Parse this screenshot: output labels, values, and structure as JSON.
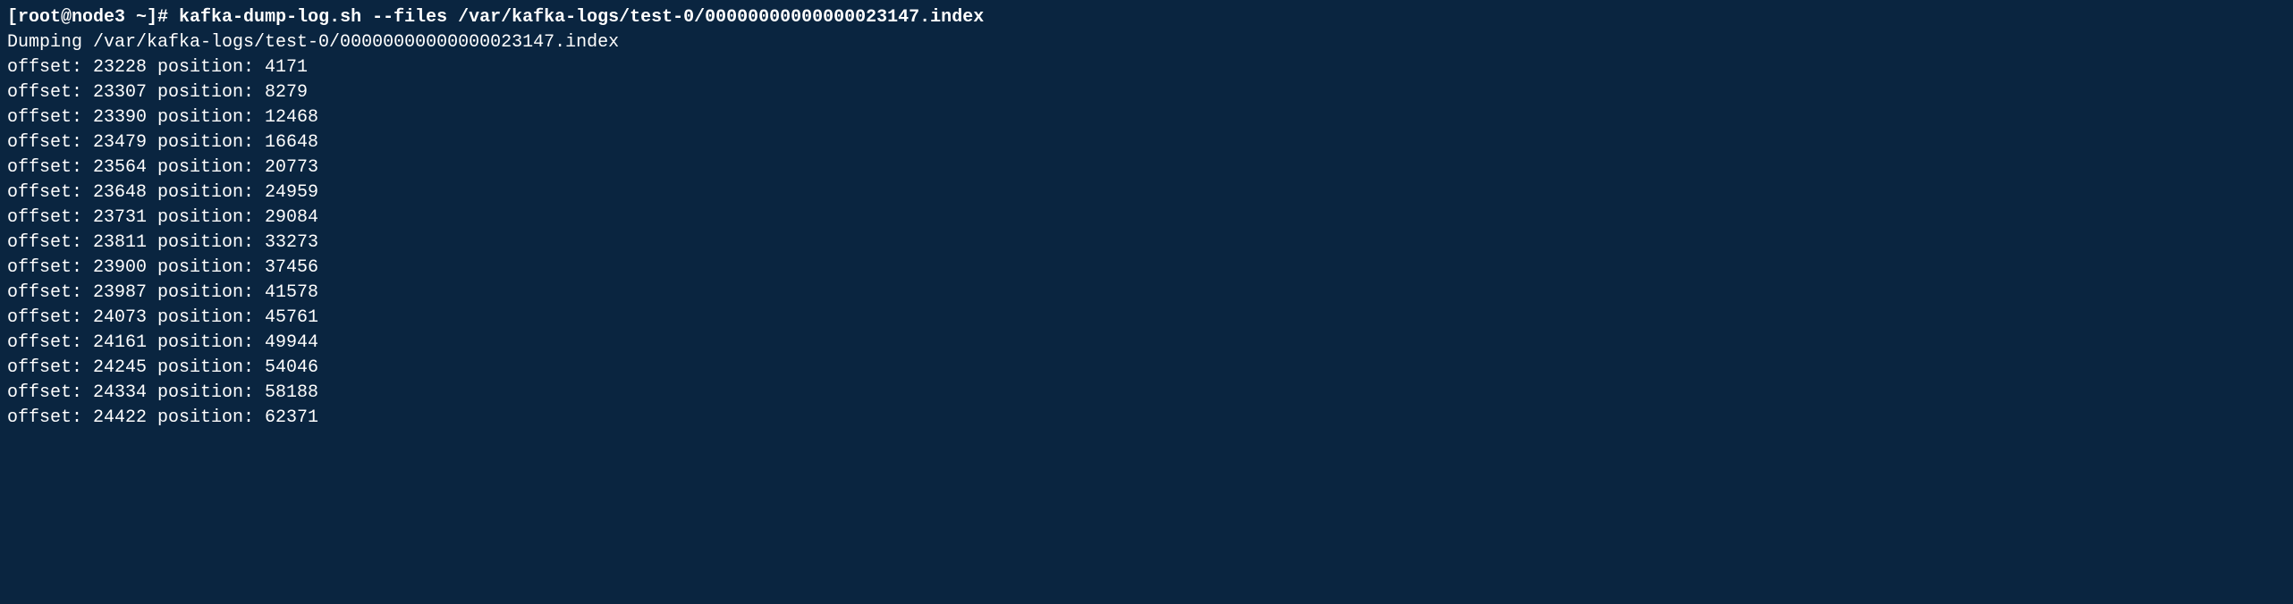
{
  "prompt": {
    "user_host": "[root@node3 ~]#",
    "command": "kafka-dump-log.sh --files /var/kafka-logs/test-0/00000000000000023147.index"
  },
  "dump_header": "Dumping /var/kafka-logs/test-0/00000000000000023147.index",
  "entries": [
    {
      "offset": "23228",
      "position": "4171"
    },
    {
      "offset": "23307",
      "position": "8279"
    },
    {
      "offset": "23390",
      "position": "12468"
    },
    {
      "offset": "23479",
      "position": "16648"
    },
    {
      "offset": "23564",
      "position": "20773"
    },
    {
      "offset": "23648",
      "position": "24959"
    },
    {
      "offset": "23731",
      "position": "29084"
    },
    {
      "offset": "23811",
      "position": "33273"
    },
    {
      "offset": "23900",
      "position": "37456"
    },
    {
      "offset": "23987",
      "position": "41578"
    },
    {
      "offset": "24073",
      "position": "45761"
    },
    {
      "offset": "24161",
      "position": "49944"
    },
    {
      "offset": "24245",
      "position": "54046"
    },
    {
      "offset": "24334",
      "position": "58188"
    },
    {
      "offset": "24422",
      "position": "62371"
    }
  ],
  "labels": {
    "offset": "offset:",
    "position": "position:"
  }
}
